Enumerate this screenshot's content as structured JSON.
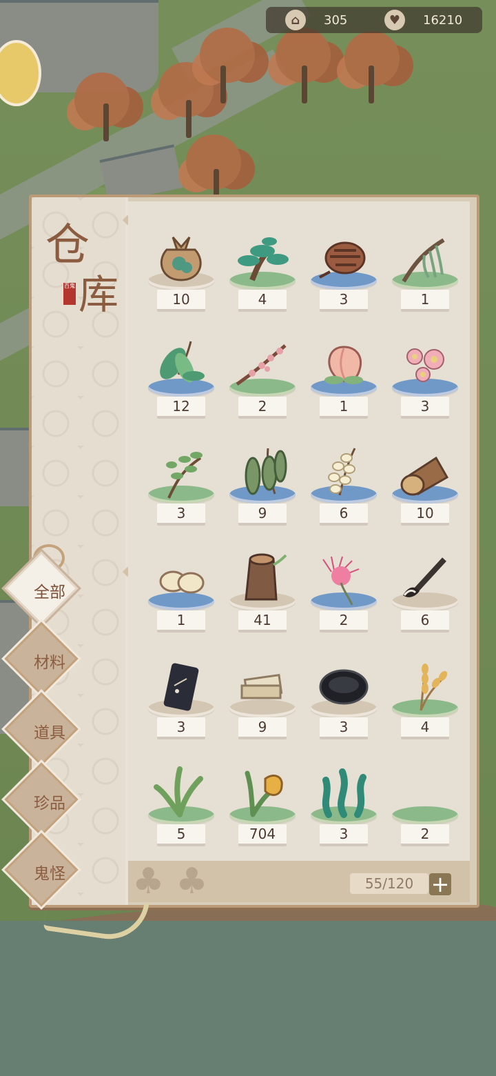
{
  "hud": {
    "resource1": {
      "icon": "temple-icon",
      "value": "305"
    },
    "resource2": {
      "icon": "heart-icon",
      "value": "16210"
    }
  },
  "panel": {
    "title_char1": "仓",
    "title_char2": "库",
    "seal_text": "百鬼",
    "capacity": "55/120",
    "plus_label": "+"
  },
  "tabs": [
    {
      "label": "全部",
      "active": true
    },
    {
      "label": "材料"
    },
    {
      "label": "道具"
    },
    {
      "label": "珍品"
    },
    {
      "label": "鬼怪"
    }
  ],
  "items": [
    {
      "name": "seed-bag",
      "count": "10",
      "base": "tan"
    },
    {
      "name": "bonsai-pine",
      "count": "4",
      "base": "green"
    },
    {
      "name": "pinecone",
      "count": "3",
      "base": "blue"
    },
    {
      "name": "willow-branch",
      "count": "1",
      "base": "green"
    },
    {
      "name": "green-leaves",
      "count": "12",
      "base": "blue"
    },
    {
      "name": "plum-blossom-branch",
      "count": "2",
      "base": "green"
    },
    {
      "name": "peach",
      "count": "1",
      "base": "blue"
    },
    {
      "name": "cherry-blossom",
      "count": "3",
      "base": "blue"
    },
    {
      "name": "herb-sprig",
      "count": "3",
      "base": "green"
    },
    {
      "name": "bean-pods",
      "count": "9",
      "base": "blue"
    },
    {
      "name": "white-flowers",
      "count": "6",
      "base": "blue"
    },
    {
      "name": "wood-log",
      "count": "10",
      "base": "blue"
    },
    {
      "name": "seeds",
      "count": "1",
      "base": "blue"
    },
    {
      "name": "tree-stump",
      "count": "41",
      "base": "tan"
    },
    {
      "name": "pink-silk-flower",
      "count": "2",
      "base": "blue"
    },
    {
      "name": "calligraphy-brush",
      "count": "6",
      "base": "tan"
    },
    {
      "name": "ink-stick",
      "count": "3",
      "base": "tan"
    },
    {
      "name": "paper-stack",
      "count": "9",
      "base": "tan"
    },
    {
      "name": "inkstone",
      "count": "3",
      "base": "tan"
    },
    {
      "name": "wheat",
      "count": "4",
      "base": "green"
    },
    {
      "name": "grass-tuft",
      "count": "5",
      "base": "green"
    },
    {
      "name": "yellow-flower-plant",
      "count": "704",
      "base": "green"
    },
    {
      "name": "seaweed",
      "count": "3",
      "base": "green"
    },
    {
      "name": "empty-slot",
      "count": "2",
      "base": "green"
    }
  ]
}
